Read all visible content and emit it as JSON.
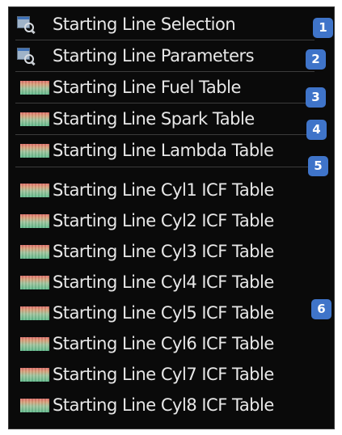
{
  "menu": {
    "items": [
      {
        "label": "Starting Line Selection",
        "icon": "selection-icon",
        "badge": "1"
      },
      {
        "label": "Starting Line Parameters",
        "icon": "selection-icon",
        "badge": "2"
      },
      {
        "label": "Starting Line Fuel Table",
        "icon": "table-icon",
        "badge": "3"
      },
      {
        "label": "Starting Line Spark Table",
        "icon": "table-icon",
        "badge": "4"
      },
      {
        "label": "Starting Line Lambda Table",
        "icon": "table-icon",
        "badge": "5"
      },
      {
        "label": "Starting Line Cyl1 ICF Table",
        "icon": "table-icon"
      },
      {
        "label": "Starting Line Cyl2 ICF Table",
        "icon": "table-icon"
      },
      {
        "label": "Starting Line Cyl3 ICF Table",
        "icon": "table-icon"
      },
      {
        "label": "Starting Line Cyl4 ICF Table",
        "icon": "table-icon"
      },
      {
        "label": "Starting Line Cyl5 ICF Table",
        "icon": "table-icon"
      },
      {
        "label": "Starting Line Cyl6 ICF Table",
        "icon": "table-icon"
      },
      {
        "label": "Starting Line Cyl7 ICF Table",
        "icon": "table-icon"
      },
      {
        "label": "Starting Line Cyl8 ICF Table",
        "icon": "table-icon"
      }
    ],
    "group_badge": "6"
  },
  "colors": {
    "background": "#0a0a0a",
    "text": "#e8e8e8",
    "badge": "#3f74c9"
  }
}
